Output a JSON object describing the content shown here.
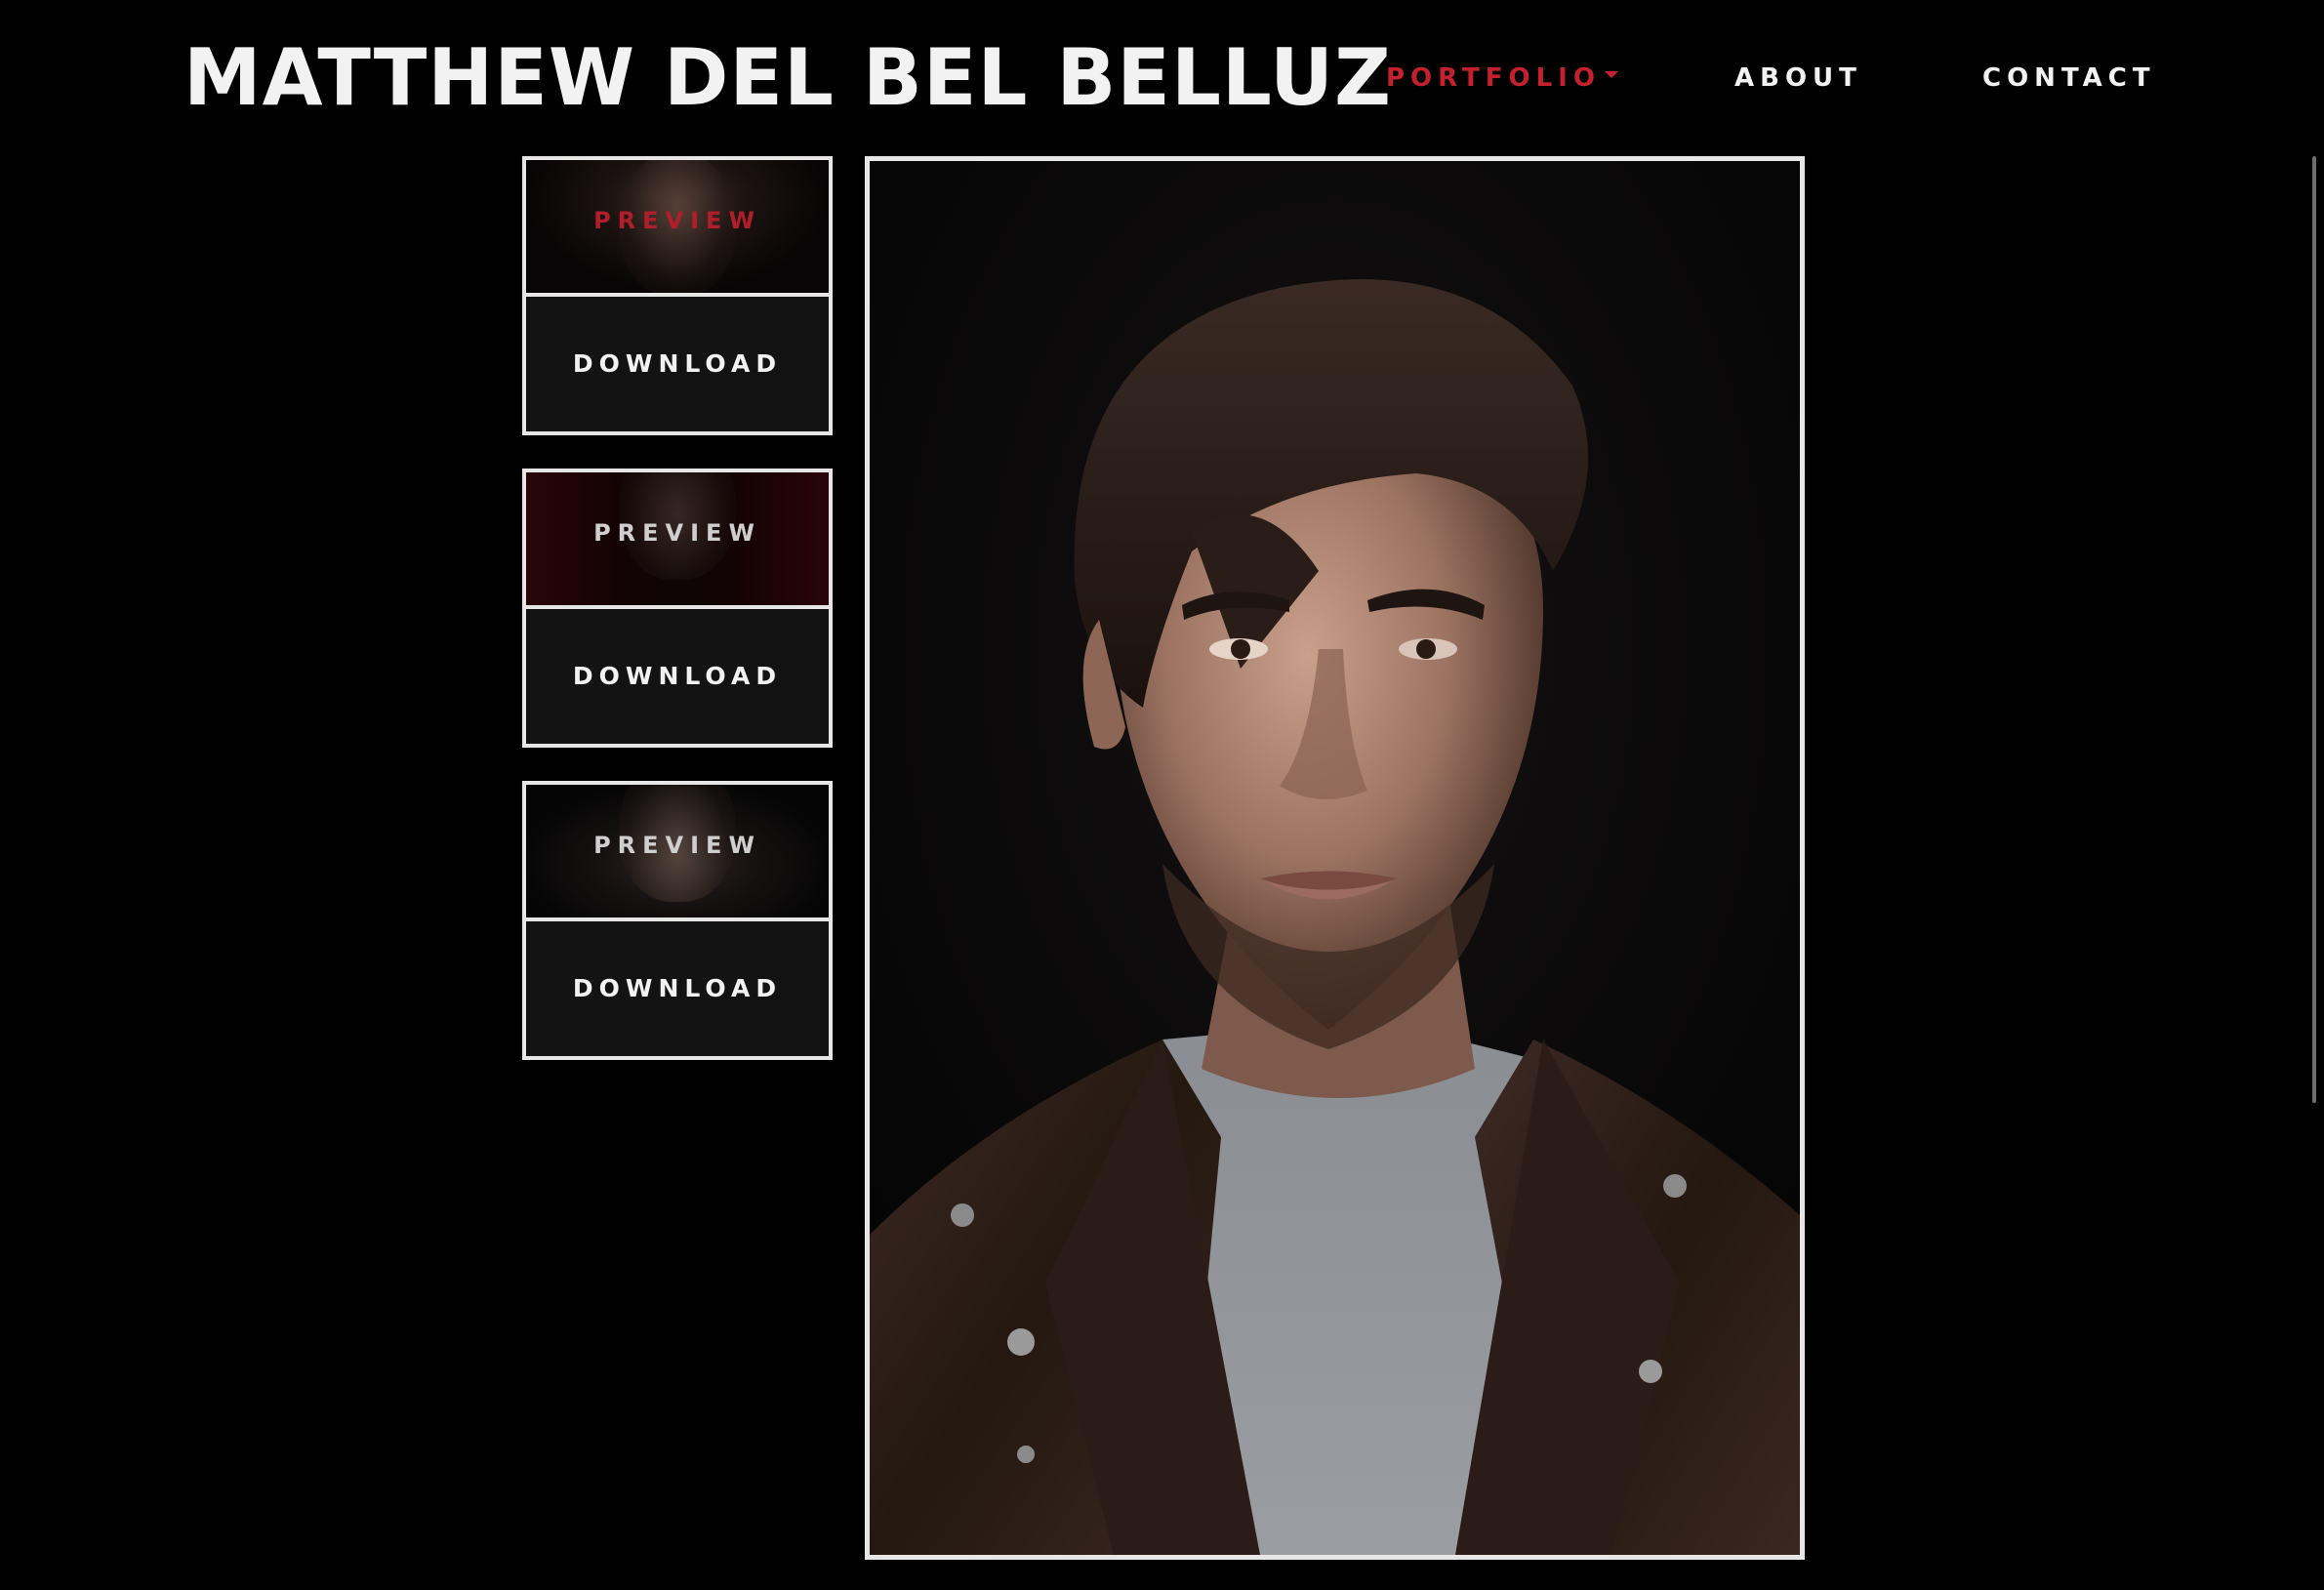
{
  "header": {
    "site_title": "MATTHEW DEL BEL BELLUZ",
    "nav": {
      "portfolio": "PORTFOLIO",
      "about": "ABOUT",
      "contact": "CONTACT"
    },
    "accent_color": "#c4202d"
  },
  "thumbnails": [
    {
      "preview_label": "PREVIEW",
      "download_label": "DOWNLOAD",
      "active": true
    },
    {
      "preview_label": "PREVIEW",
      "download_label": "DOWNLOAD",
      "active": false
    },
    {
      "preview_label": "PREVIEW",
      "download_label": "DOWNLOAD",
      "active": false
    }
  ]
}
